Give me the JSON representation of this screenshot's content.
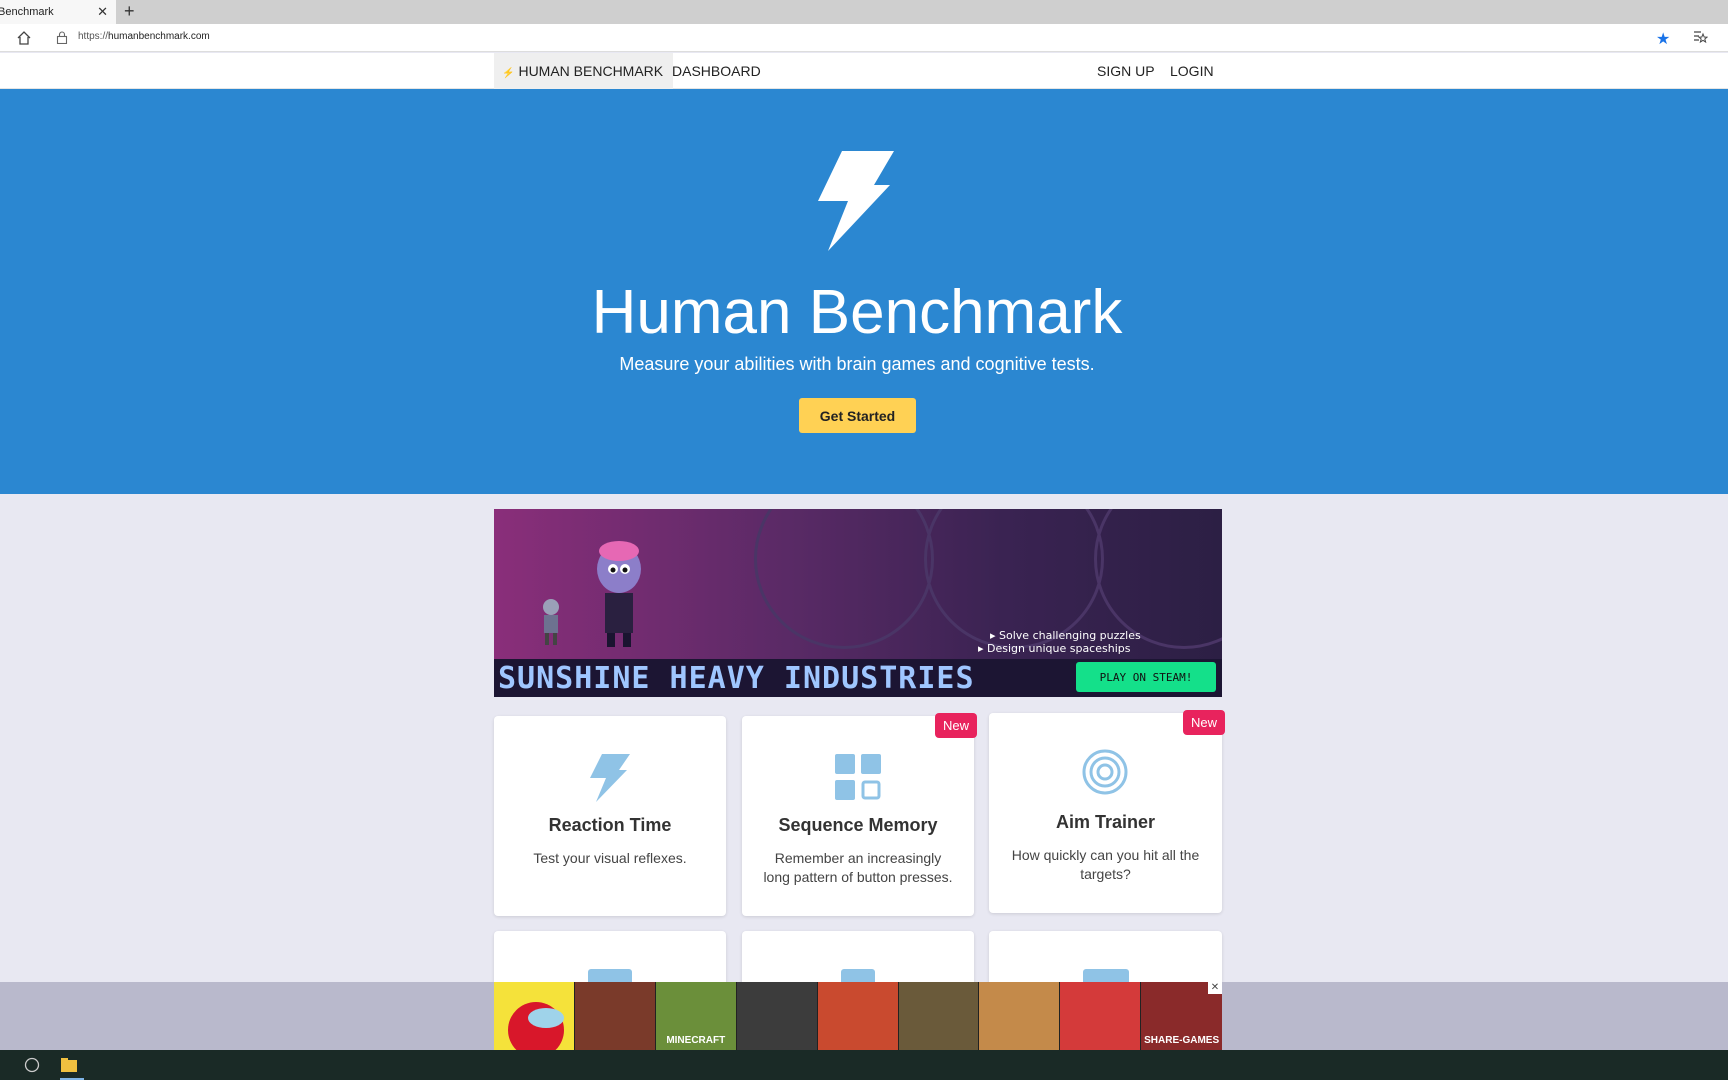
{
  "browser": {
    "tab_title": "Benchmark",
    "url_scheme": "https://",
    "url_host": "humanbenchmark.com"
  },
  "nav": {
    "brand": "HUMAN BENCHMARK",
    "dashboard": "DASHBOARD",
    "signup": "SIGN UP",
    "login": "LOGIN"
  },
  "hero": {
    "title": "Human Benchmark",
    "subtitle": "Measure your abilities with brain games and cognitive tests.",
    "cta": "Get Started",
    "bg_color": "#2b87d1",
    "cta_color": "#ffd154"
  },
  "ad": {
    "title": "SUNSHINE HEAVY INDUSTRIES",
    "bullets": [
      "Solve challenging puzzles",
      "Design unique spaceships"
    ],
    "cta": "PLAY ON STEAM!"
  },
  "cards": [
    {
      "title": "Reaction Time",
      "desc": "Test your visual reflexes.",
      "icon": "lightning-bolt-icon",
      "badge": ""
    },
    {
      "title": "Sequence Memory",
      "desc": "Remember an increasingly long pattern of button presses.",
      "icon": "grid-squares-icon",
      "badge": "New"
    },
    {
      "title": "Aim Trainer",
      "desc": "How quickly can you hit all the targets?",
      "icon": "target-icon",
      "badge": "New"
    }
  ],
  "bottom_ad": {
    "games": [
      "",
      "",
      "MINECRAFT",
      "",
      "",
      "",
      "",
      "",
      "SHARE-GAMES"
    ],
    "close": "✕"
  },
  "colors": {
    "badge": "#e8235d",
    "icon_blue": "#8fc3e6",
    "page_bg": "#e8e8f2"
  }
}
